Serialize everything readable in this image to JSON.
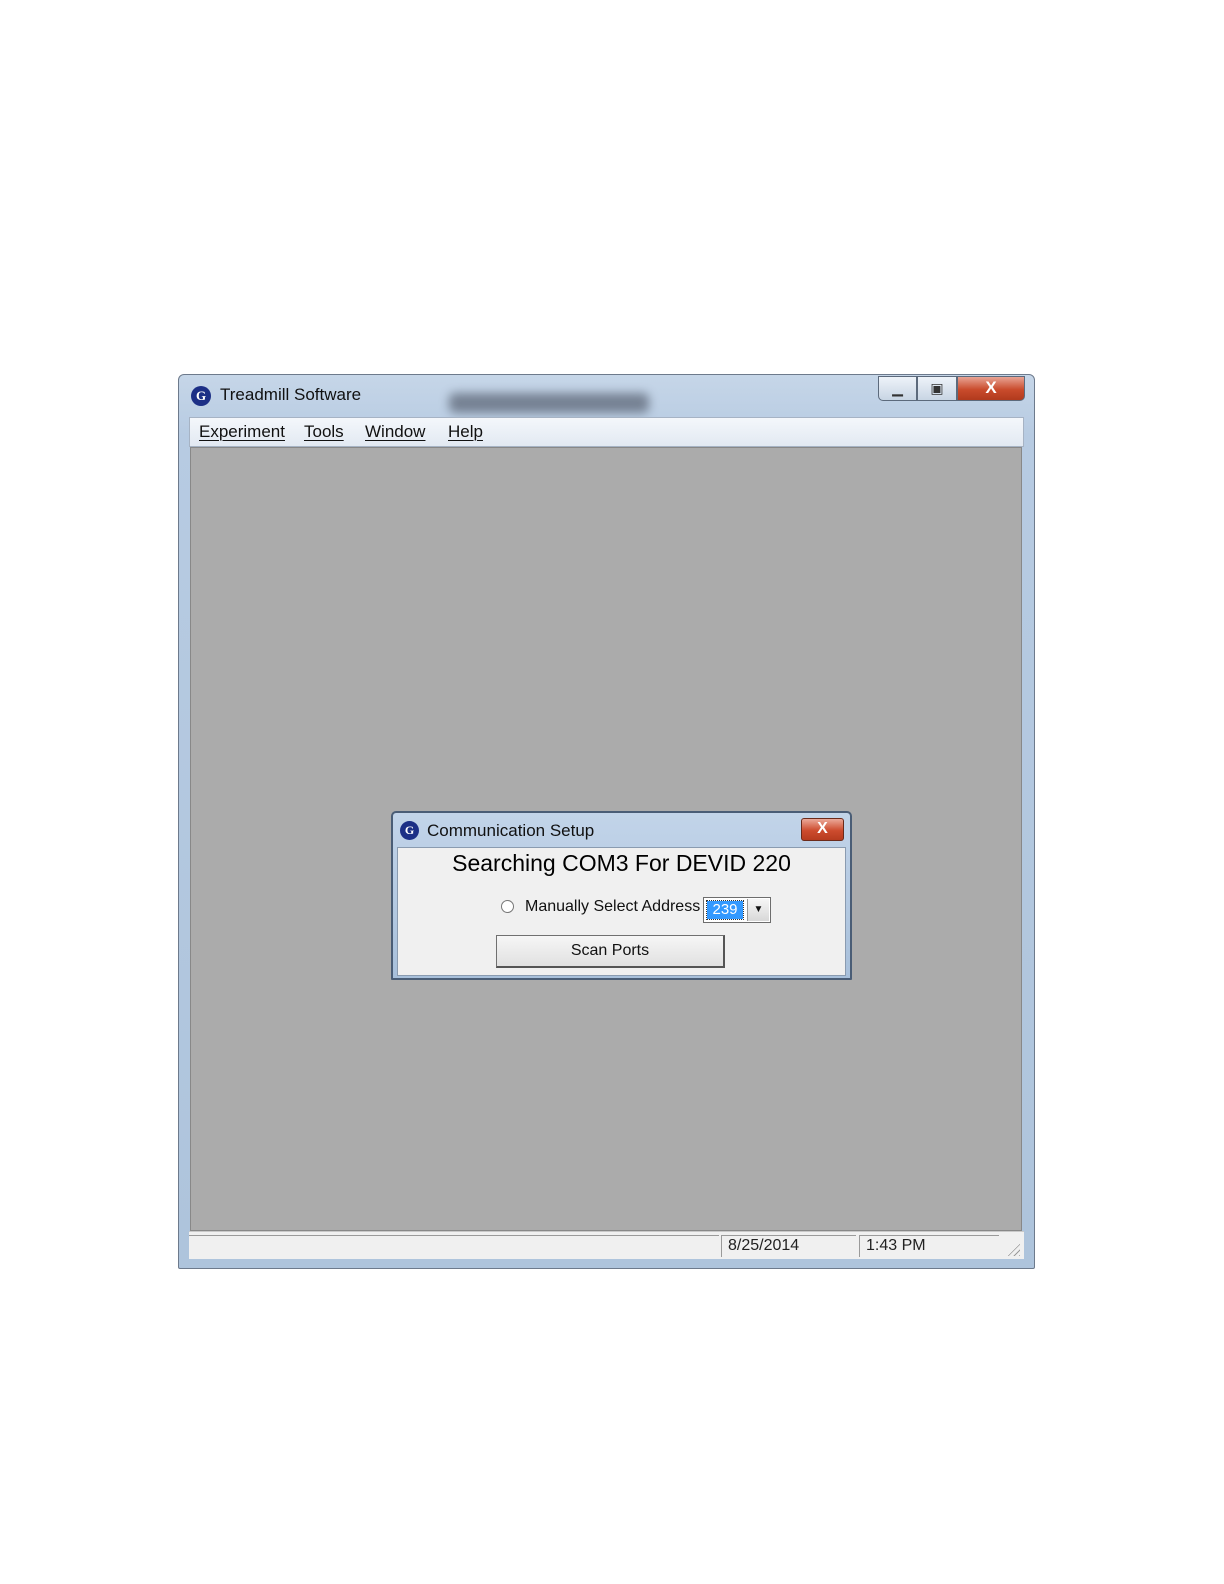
{
  "window": {
    "title": "Treadmill Software",
    "icon": "treadmill-app-icon",
    "caption_buttons": {
      "minimize": "minimize-icon",
      "maximize": "maximize-icon",
      "close": "X"
    }
  },
  "menu": {
    "items": [
      {
        "label": "Experiment"
      },
      {
        "label": "Tools"
      },
      {
        "label": "Window"
      },
      {
        "label": "Help"
      }
    ]
  },
  "dialog": {
    "title": "Communication Setup",
    "close_label": "X",
    "status_message": "Searching COM3 For DEVID 220",
    "radio_label": "Manually Select Address",
    "address_value": "239",
    "scan_button_label": "Scan Ports"
  },
  "statusbar": {
    "date": "8/25/2014",
    "time": "1:43 PM"
  },
  "colors": {
    "mdi_background": "#ababab",
    "title_gradient": "#b7cbe2",
    "close_red": "#c94b2c",
    "selection_blue": "#3399ff"
  }
}
